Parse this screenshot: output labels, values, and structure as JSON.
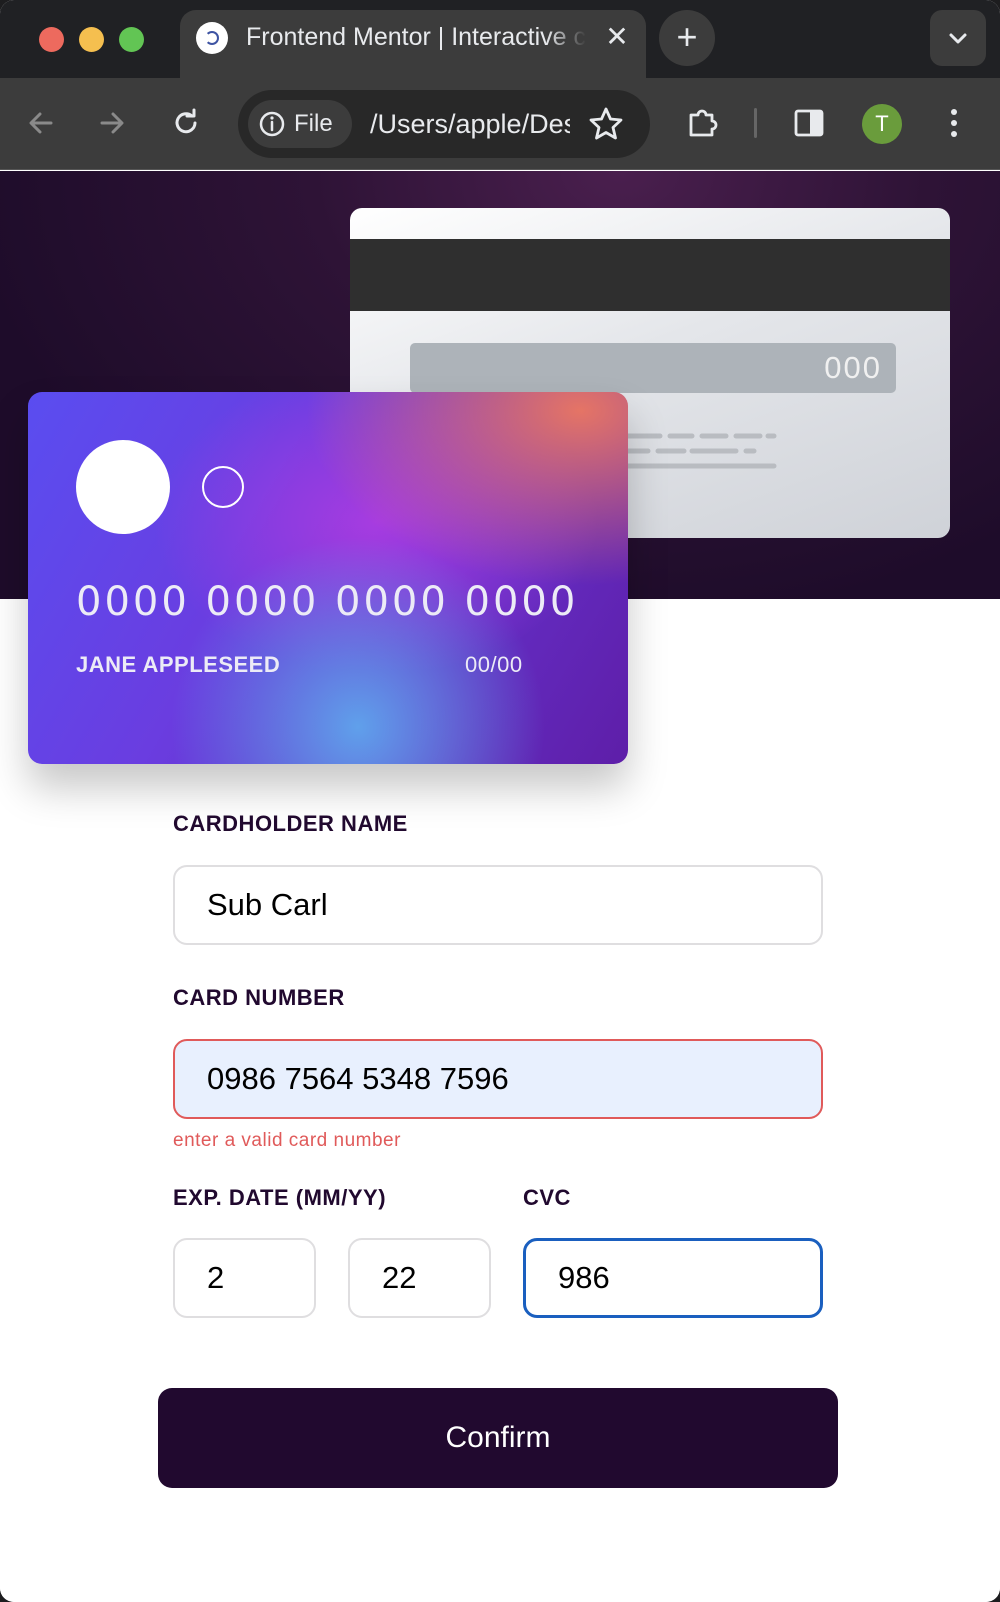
{
  "browser": {
    "tab_title": "Frontend Mentor | Interactive card details form",
    "tab_close": "✕",
    "new_tab": "+",
    "site_chip": "File",
    "url": "/Users/apple/Desktop/interactive-card-details-form/index.html",
    "profile_initial": "T",
    "colors": {
      "profile": "#6a9c3c",
      "tabstrip": "#202124",
      "toolbar": "#3c3c3c"
    }
  },
  "card_back": {
    "cvc": "000"
  },
  "card_front": {
    "number": "0000 0000 0000 0000",
    "name": "JANE APPLESEED",
    "expiry": "00/00"
  },
  "form": {
    "cardholder_label": "CARDHOLDER NAME",
    "cardholder_value": "Sub Carl",
    "number_label": "CARD NUMBER",
    "number_value": "0986 7564 5348 7596",
    "number_error": "enter a valid card number",
    "exp_label": "EXP. DATE (MM/YY)",
    "exp_month": "2",
    "exp_year": "22",
    "cvc_label": "CVC",
    "cvc_value": "986",
    "confirm_label": "Confirm"
  },
  "colors": {
    "accent_dark": "#21092f",
    "error": "#e05a5a",
    "focus": "#1a5fbf"
  }
}
